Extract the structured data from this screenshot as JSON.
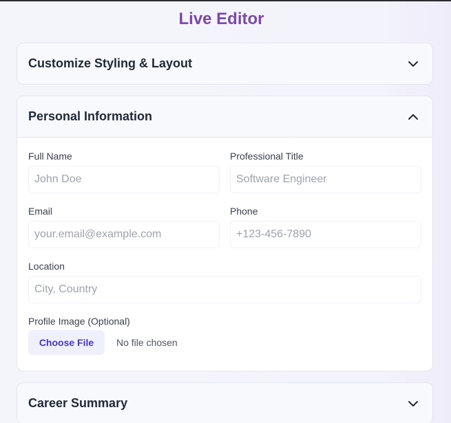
{
  "header": {
    "title": "Live Editor"
  },
  "panels": [
    {
      "title": "Customize Styling & Layout",
      "expanded": false,
      "chevron_icon": "chevron-down-icon"
    },
    {
      "title": "Personal Information",
      "expanded": true,
      "chevron_icon": "chevron-up-icon"
    },
    {
      "title": "Career Summary",
      "expanded": false,
      "chevron_icon": "chevron-down-icon"
    }
  ],
  "personal_info": {
    "full_name": {
      "label": "Full Name",
      "placeholder": "John Doe",
      "value": ""
    },
    "professional_title": {
      "label": "Professional Title",
      "placeholder": "Software Engineer",
      "value": ""
    },
    "email": {
      "label": "Email",
      "placeholder": "your.email@example.com",
      "value": ""
    },
    "phone": {
      "label": "Phone",
      "placeholder": "+123-456-7890",
      "value": ""
    },
    "location": {
      "label": "Location",
      "placeholder": "City, Country",
      "value": ""
    },
    "profile_image": {
      "label": "Profile Image (Optional)",
      "button_label": "Choose File",
      "status": "No file chosen"
    }
  },
  "colors": {
    "accent": "#7b4aa3",
    "file_button_text": "#4338ca",
    "file_button_bg": "#eef0fb"
  }
}
